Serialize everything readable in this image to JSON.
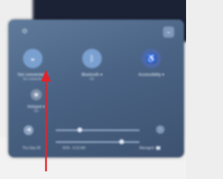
{
  "panel": {
    "settings_icon": "settings-gear-icon",
    "collapse_icon": "chevron-down-icon"
  },
  "tiles": [
    {
      "name": "wifi",
      "icon": "wifi-icon",
      "label": "Not connected ▾",
      "sub": "No networks"
    },
    {
      "name": "bluetooth",
      "icon": "bluetooth-icon",
      "label": "Bluetooth ▾",
      "sub": "On"
    },
    {
      "name": "accessibility",
      "icon": "accessibility-icon",
      "label": "Accessibility ▾",
      "sub": ""
    },
    {
      "name": "hotspot",
      "icon": "hotspot-icon",
      "label": "Hotspot ▾",
      "sub": "On"
    }
  ],
  "sliders": {
    "volume": {
      "icon": "volume-icon",
      "level": 0.28
    },
    "brightness": {
      "icon": "brightness-icon",
      "level": 0.78
    }
  },
  "status": {
    "date": "Thu Sep 28",
    "battery": "91% · 5:12 left",
    "managed": "Managed"
  },
  "annotation": {
    "color": "#e0242b"
  }
}
